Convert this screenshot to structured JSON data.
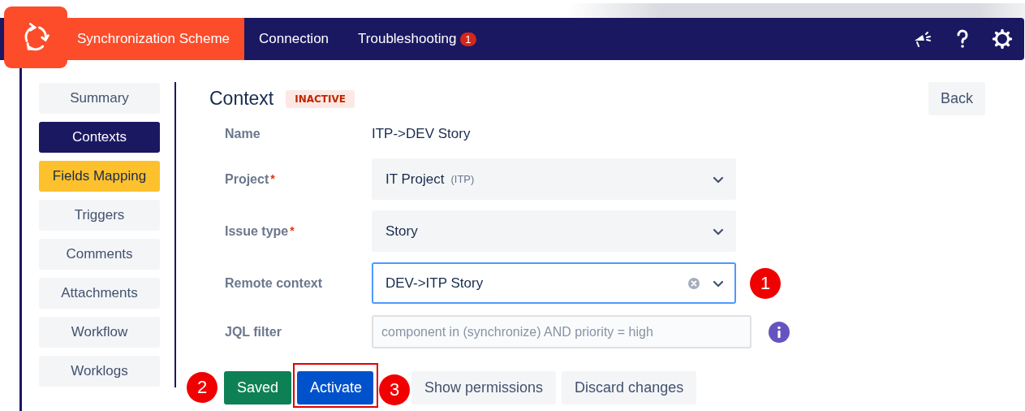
{
  "nav": {
    "tabs": [
      {
        "label": "Synchronization Scheme",
        "selected": true
      },
      {
        "label": "Connection",
        "selected": false
      },
      {
        "label": "Troubleshooting",
        "selected": false,
        "badge": "1"
      }
    ]
  },
  "sidebar": {
    "items": [
      {
        "label": "Summary",
        "selected": false,
        "highlighted": false
      },
      {
        "label": "Contexts",
        "selected": true,
        "highlighted": false
      },
      {
        "label": "Fields Mapping",
        "selected": false,
        "highlighted": true
      },
      {
        "label": "Triggers",
        "selected": false,
        "highlighted": false
      },
      {
        "label": "Comments",
        "selected": false,
        "highlighted": false
      },
      {
        "label": "Attachments",
        "selected": false,
        "highlighted": false
      },
      {
        "label": "Workflow",
        "selected": false,
        "highlighted": false
      },
      {
        "label": "Worklogs",
        "selected": false,
        "highlighted": false
      }
    ]
  },
  "context": {
    "title": "Context",
    "status": "INACTIVE",
    "back_button": "Back"
  },
  "form": [
    {
      "kind": "text",
      "label": "Name",
      "value": "ITP->DEV Story"
    },
    {
      "kind": "select",
      "label": "Project",
      "required": "*",
      "value": "IT Project",
      "hint": "(ITP)",
      "focused": false
    },
    {
      "kind": "select",
      "label": "Issue type",
      "required": "*",
      "value": "Story",
      "focused": false
    },
    {
      "kind": "select",
      "label": "Remote context",
      "value": "DEV->ITP Story",
      "focused": true,
      "clearable": true,
      "callout": "1"
    },
    {
      "kind": "input",
      "label": "JQL filter",
      "placeholder": "component in (synchronize) AND priority = high",
      "info": true
    }
  ],
  "buttons": [
    {
      "kind": "success",
      "label": "Saved",
      "callout_before": "2"
    },
    {
      "kind": "primary",
      "label": "Activate",
      "callout_after": "3",
      "outlined": true
    },
    {
      "kind": "default",
      "label": "Show permissions"
    },
    {
      "kind": "default",
      "label": "Discard changes"
    }
  ]
}
